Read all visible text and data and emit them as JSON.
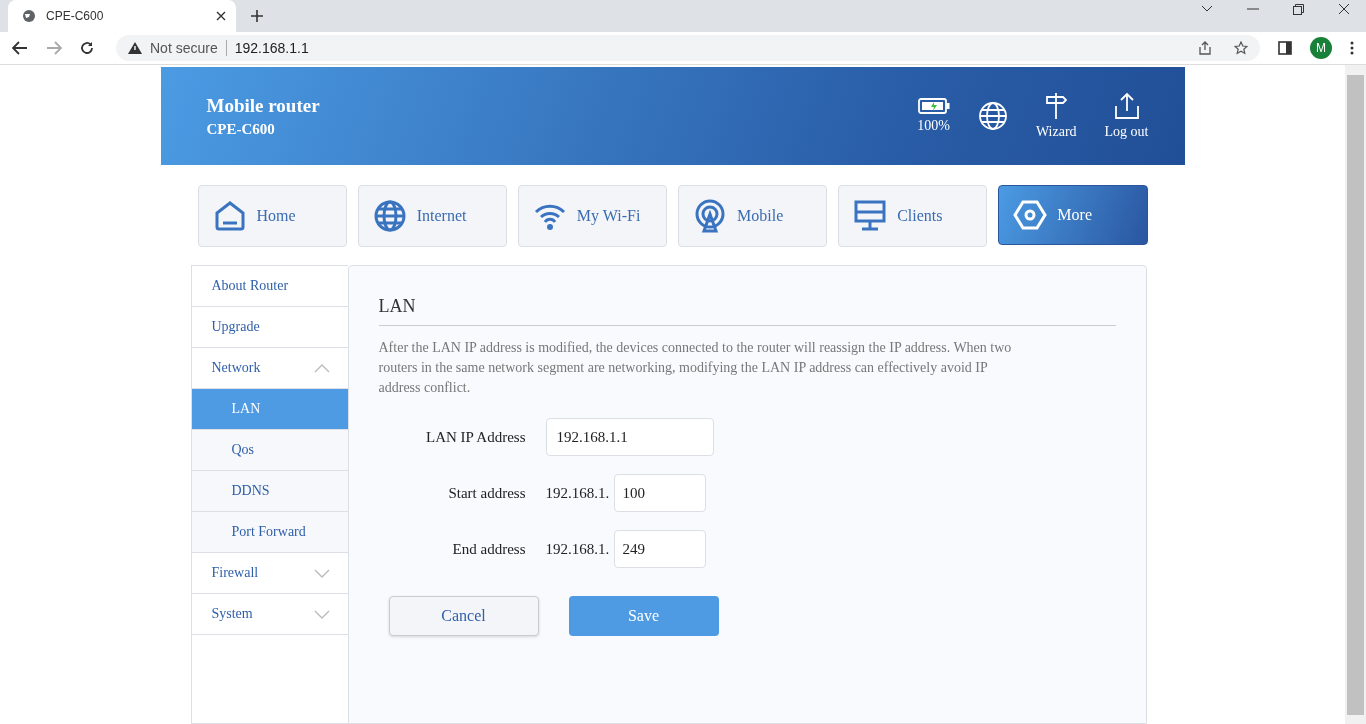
{
  "browser": {
    "tab_title": "CPE-C600",
    "security": "Not secure",
    "url": "192.168.1.1",
    "profile_initial": "M"
  },
  "header": {
    "title": "Mobile router",
    "subtitle": "CPE-C600",
    "battery": "100%",
    "actions": [
      "Wizard",
      "Log out"
    ]
  },
  "nav": [
    {
      "label": "Home",
      "selected": false
    },
    {
      "label": "Internet",
      "selected": false
    },
    {
      "label": "My Wi-Fi",
      "selected": false
    },
    {
      "label": "Mobile",
      "selected": false
    },
    {
      "label": "Clients",
      "selected": false
    },
    {
      "label": "More",
      "selected": true
    }
  ],
  "sidebar": [
    {
      "kind": "item",
      "label": "About Router",
      "selected": false
    },
    {
      "kind": "item",
      "label": "Upgrade",
      "selected": false
    },
    {
      "kind": "group",
      "label": "Network",
      "expanded": true,
      "children": [
        {
          "label": "LAN",
          "selected": true
        },
        {
          "label": "Qos",
          "selected": false
        },
        {
          "label": "DDNS",
          "selected": false
        },
        {
          "label": "Port Forward",
          "selected": false
        }
      ]
    },
    {
      "kind": "group",
      "label": "Firewall",
      "expanded": false
    },
    {
      "kind": "group",
      "label": "System",
      "expanded": false
    }
  ],
  "section": {
    "title": "LAN",
    "description": "After the LAN IP address is modified, the devices connected to the router will reassign the IP address. When two routers in the same network segment are networking, modifying the LAN IP address can effectively avoid IP address conflict.",
    "fields": [
      {
        "label": "LAN IP Address",
        "value": "192.168.1.1"
      },
      {
        "label": "Start address",
        "prefix": "192.168.1.",
        "value": "100"
      },
      {
        "label": "End address",
        "prefix": "192.168.1.",
        "value": "249"
      }
    ],
    "buttons": [
      "Cancel",
      "Save"
    ]
  }
}
